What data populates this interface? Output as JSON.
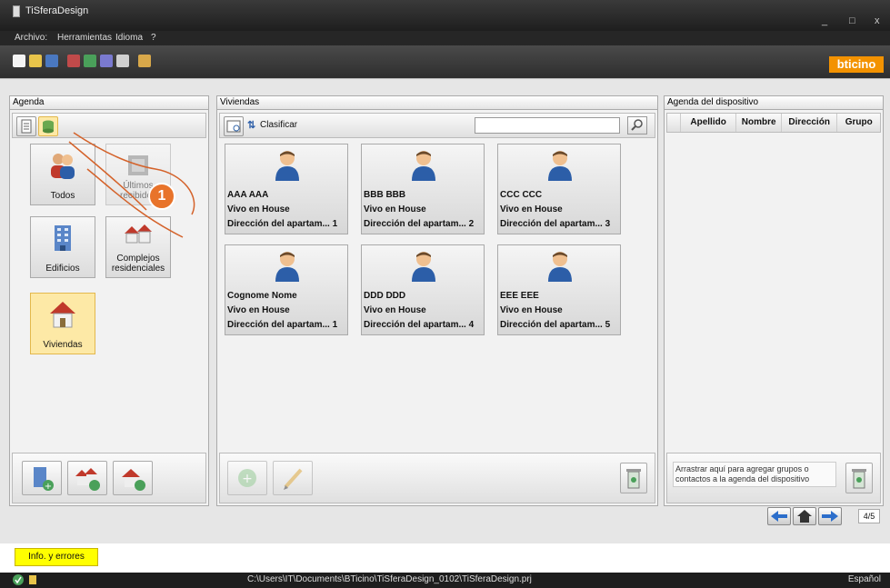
{
  "window": {
    "title": "TiSferaDesign",
    "minimize_glyph": "_",
    "maximize_glyph": "□",
    "close_glyph": "x"
  },
  "menu": {
    "items": [
      "Archivo:",
      "Herramientas",
      "Idioma",
      "?"
    ]
  },
  "brand": "bticino",
  "agenda": {
    "header": "Agenda",
    "categories": [
      {
        "label": "Todos",
        "icon": "people-icon"
      },
      {
        "label": "Últimos recibidos",
        "icon": "recent-icon"
      },
      {
        "label": "Edificios",
        "icon": "building-icon"
      },
      {
        "label": "Complejos residenciales",
        "icon": "houses-icon"
      },
      {
        "label": "Viviendas",
        "icon": "house-icon",
        "selected": true
      }
    ]
  },
  "viviendas": {
    "header": "Viviendas",
    "sort_label": "Clasificar",
    "search_value": "",
    "cards": [
      {
        "name": "AAA AAA",
        "status": "Vivo en House",
        "address": "Dirección del apartam... 1"
      },
      {
        "name": "BBB BBB",
        "status": "Vivo en House",
        "address": "Dirección del apartam... 2"
      },
      {
        "name": "CCC CCC",
        "status": "Vivo en House",
        "address": "Dirección del apartam... 3"
      },
      {
        "name": "Cognome Nome",
        "status": "Vivo en House",
        "address": "Dirección del apartam... 1"
      },
      {
        "name": "DDD DDD",
        "status": "Vivo en House",
        "address": "Dirección del apartam... 4"
      },
      {
        "name": "EEE EEE",
        "status": "Vivo en House",
        "address": "Dirección del apartam... 5"
      }
    ]
  },
  "device_agenda": {
    "header": "Agenda del dispositivo",
    "columns": [
      "Apellido",
      "Nombre",
      "Dirección",
      "Grupo"
    ],
    "drop_hint": "Arrastrar aquí para agregar grupos o contactos a la agenda del dispositivo"
  },
  "navigation": {
    "page": "4/5"
  },
  "info_tab": "Info. y errores",
  "status": {
    "path": "C:\\Users\\IT\\Documents\\BTicino\\TiSferaDesign_0102\\TiSferaDesign.prj",
    "language": "Español"
  },
  "callout_number": "1",
  "colors": {
    "brand": "#f39200",
    "selected_tile": "#fde9a6",
    "callout": "#e8732a",
    "info_tab": "#ffff00"
  }
}
